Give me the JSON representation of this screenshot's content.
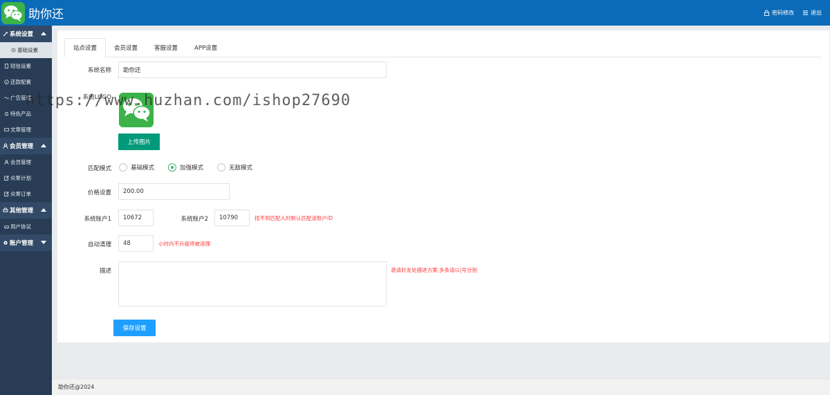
{
  "app": {
    "title": "助你还"
  },
  "header": {
    "password_label": "密码修改",
    "logout_label": "退出"
  },
  "sidebar": {
    "groups": [
      {
        "label": "系统设置",
        "expanded": true,
        "items": [
          "基础设置",
          "短信设置",
          "还款配置",
          "广告管理",
          "特色产品",
          "文章管理"
        ]
      },
      {
        "label": "会员管理",
        "expanded": true,
        "items": [
          "会员管理",
          "众筹计划",
          "众筹订单"
        ]
      },
      {
        "label": "其他管理",
        "expanded": true,
        "items": [
          "用户协议"
        ]
      },
      {
        "label": "账户管理",
        "expanded": false,
        "items": []
      }
    ],
    "active_item": "基础设置"
  },
  "tabs": [
    "站点设置",
    "会员设置",
    "客服设置",
    "APP设置"
  ],
  "form": {
    "system_name_label": "系统名称",
    "system_name_value": "助你还",
    "system_logo_label": "系统LOGO",
    "upload_button": "上传图片",
    "match_mode_label": "匹配模式",
    "match_modes": [
      "基础模式",
      "加强模式",
      "无敌模式"
    ],
    "match_mode_selected": "加强模式",
    "price_label": "价格设置",
    "price_value": "200.00",
    "account1_label": "系统账户1",
    "account1_value": "10672",
    "account2_label": "系统账户2",
    "account2_value": "10790",
    "account_hint": "找不到匹配人时默认匹配该账户ID",
    "auto_clean_label": "自动清理",
    "auto_clean_value": "48",
    "auto_clean_hint": "小时内不升级将被清理",
    "description_label": "描述",
    "description_value": "",
    "description_hint": "邀请好友处描述方案,多条请以|号分割",
    "save_button": "保存设置"
  },
  "watermark": "https://www.huzhan.com/ishop27690",
  "footer": {
    "text": "助你还@2024"
  },
  "colors": {
    "header_bg": "#0b6bb8",
    "sidebar_bg": "#283d55",
    "upload_btn": "#009a7a",
    "save_btn": "#1e9fff",
    "hint_red": "#ff3b3b",
    "logo_green": "#3cb34a"
  }
}
